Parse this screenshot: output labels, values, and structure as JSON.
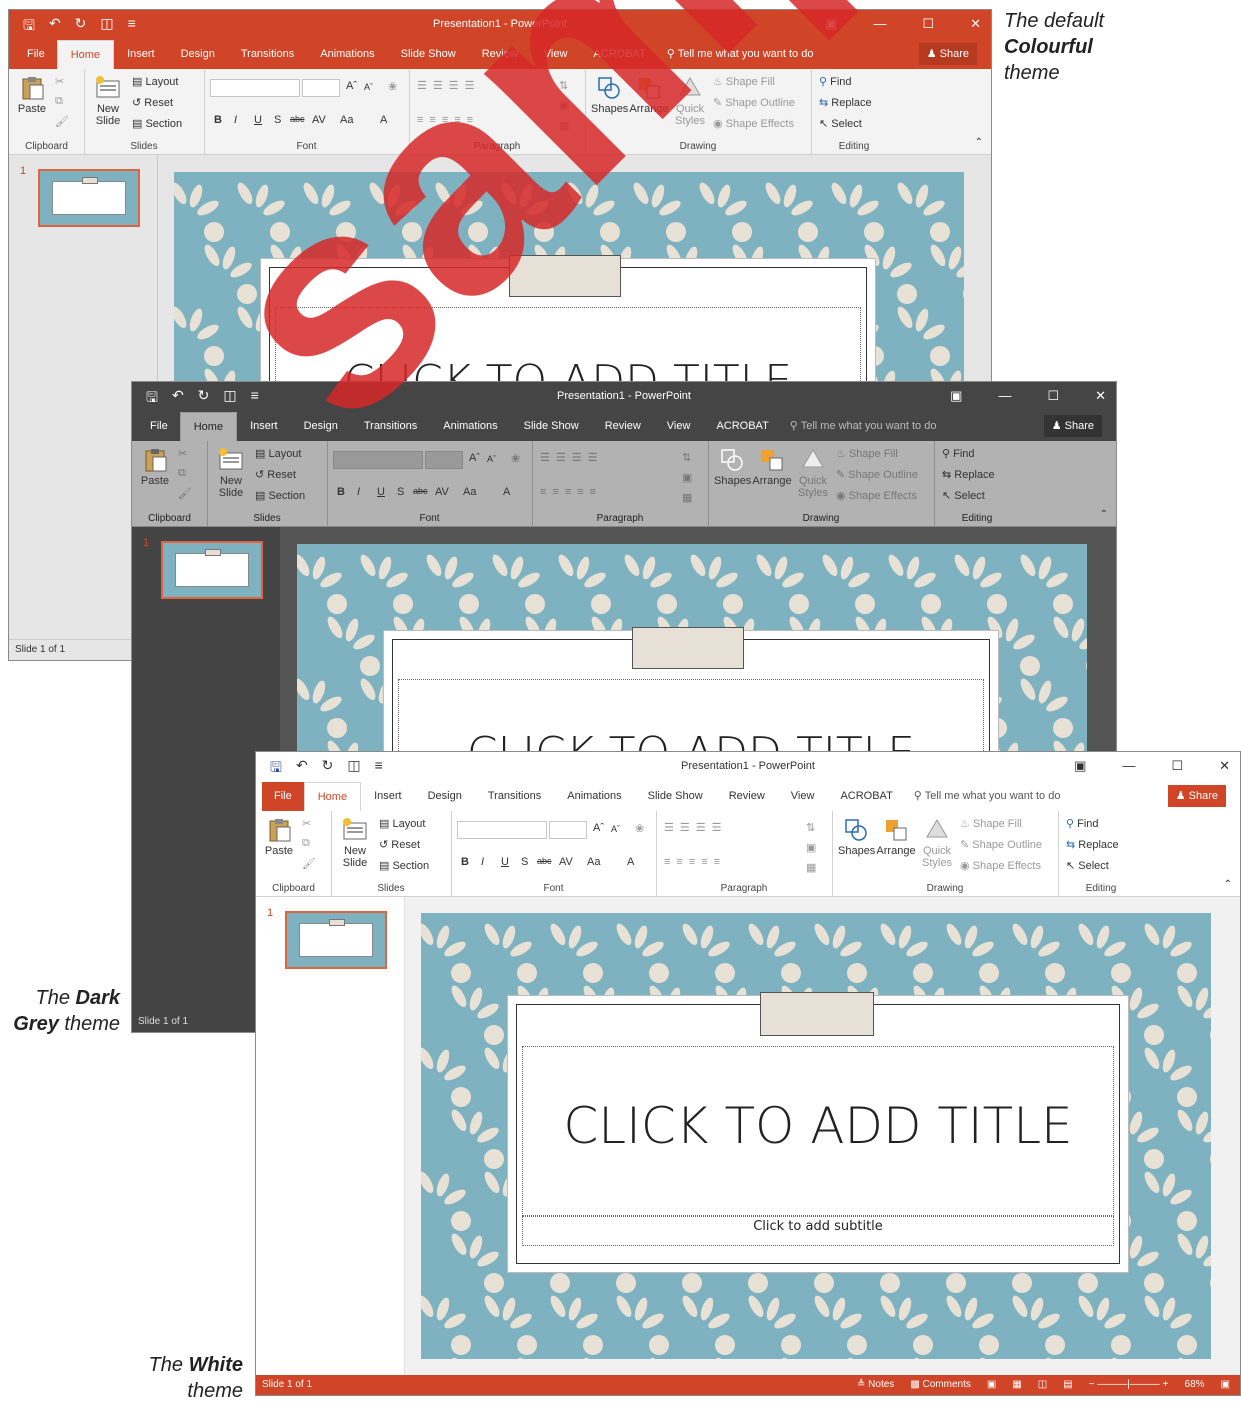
{
  "captions": {
    "colourful": {
      "pre": "The default",
      "bold": "Colourful",
      "post": "theme"
    },
    "darkgrey": {
      "pre": "The",
      "bold": "Dark",
      "bold2": "Grey",
      "post": "theme"
    },
    "white": {
      "pre": "The",
      "bold": "White",
      "post": "theme"
    }
  },
  "window": {
    "title": "Presentation1 - PowerPoint",
    "tabs": [
      "File",
      "Home",
      "Insert",
      "Design",
      "Transitions",
      "Animations",
      "Slide Show",
      "Review",
      "View",
      "ACROBAT"
    ],
    "tell_me": "Tell me what you want to do",
    "share": "Share"
  },
  "ribbon": {
    "clipboard": {
      "paste": "Paste",
      "label": "Clipboard"
    },
    "slides": {
      "new_slide": "New",
      "new_slide2": "Slide",
      "layout": "Layout",
      "reset": "Reset",
      "section": "Section",
      "label": "Slides"
    },
    "font": {
      "bold": "B",
      "italic": "I",
      "underline": "U",
      "shadow": "S",
      "strike": "abc",
      "spacing": "AV",
      "case": "Aa",
      "color": "A",
      "grow": "A",
      "shrink": "A",
      "label": "Font"
    },
    "paragraph": {
      "label": "Paragraph"
    },
    "drawing": {
      "shapes": "Shapes",
      "arrange": "Arrange",
      "quick": "Quick",
      "styles": "Styles",
      "fill": "Shape Fill",
      "outline": "Shape Outline",
      "effects": "Shape Effects",
      "label": "Drawing"
    },
    "editing": {
      "find": "Find",
      "replace": "Replace",
      "select": "Select",
      "label": "Editing"
    }
  },
  "slide_panel": {
    "number": "1"
  },
  "slide": {
    "title": "CLICK TO ADD TITLE",
    "subtitle": "Click to add subtitle"
  },
  "status": {
    "slide_info": "Slide 1 of 1",
    "notes": "Notes",
    "comments": "Comments",
    "zoom": "68%"
  },
  "watermark": "sample",
  "colors": {
    "accent": "#d04527",
    "slide_bg": "#7fb2c1",
    "dark_grey": "#454545"
  }
}
